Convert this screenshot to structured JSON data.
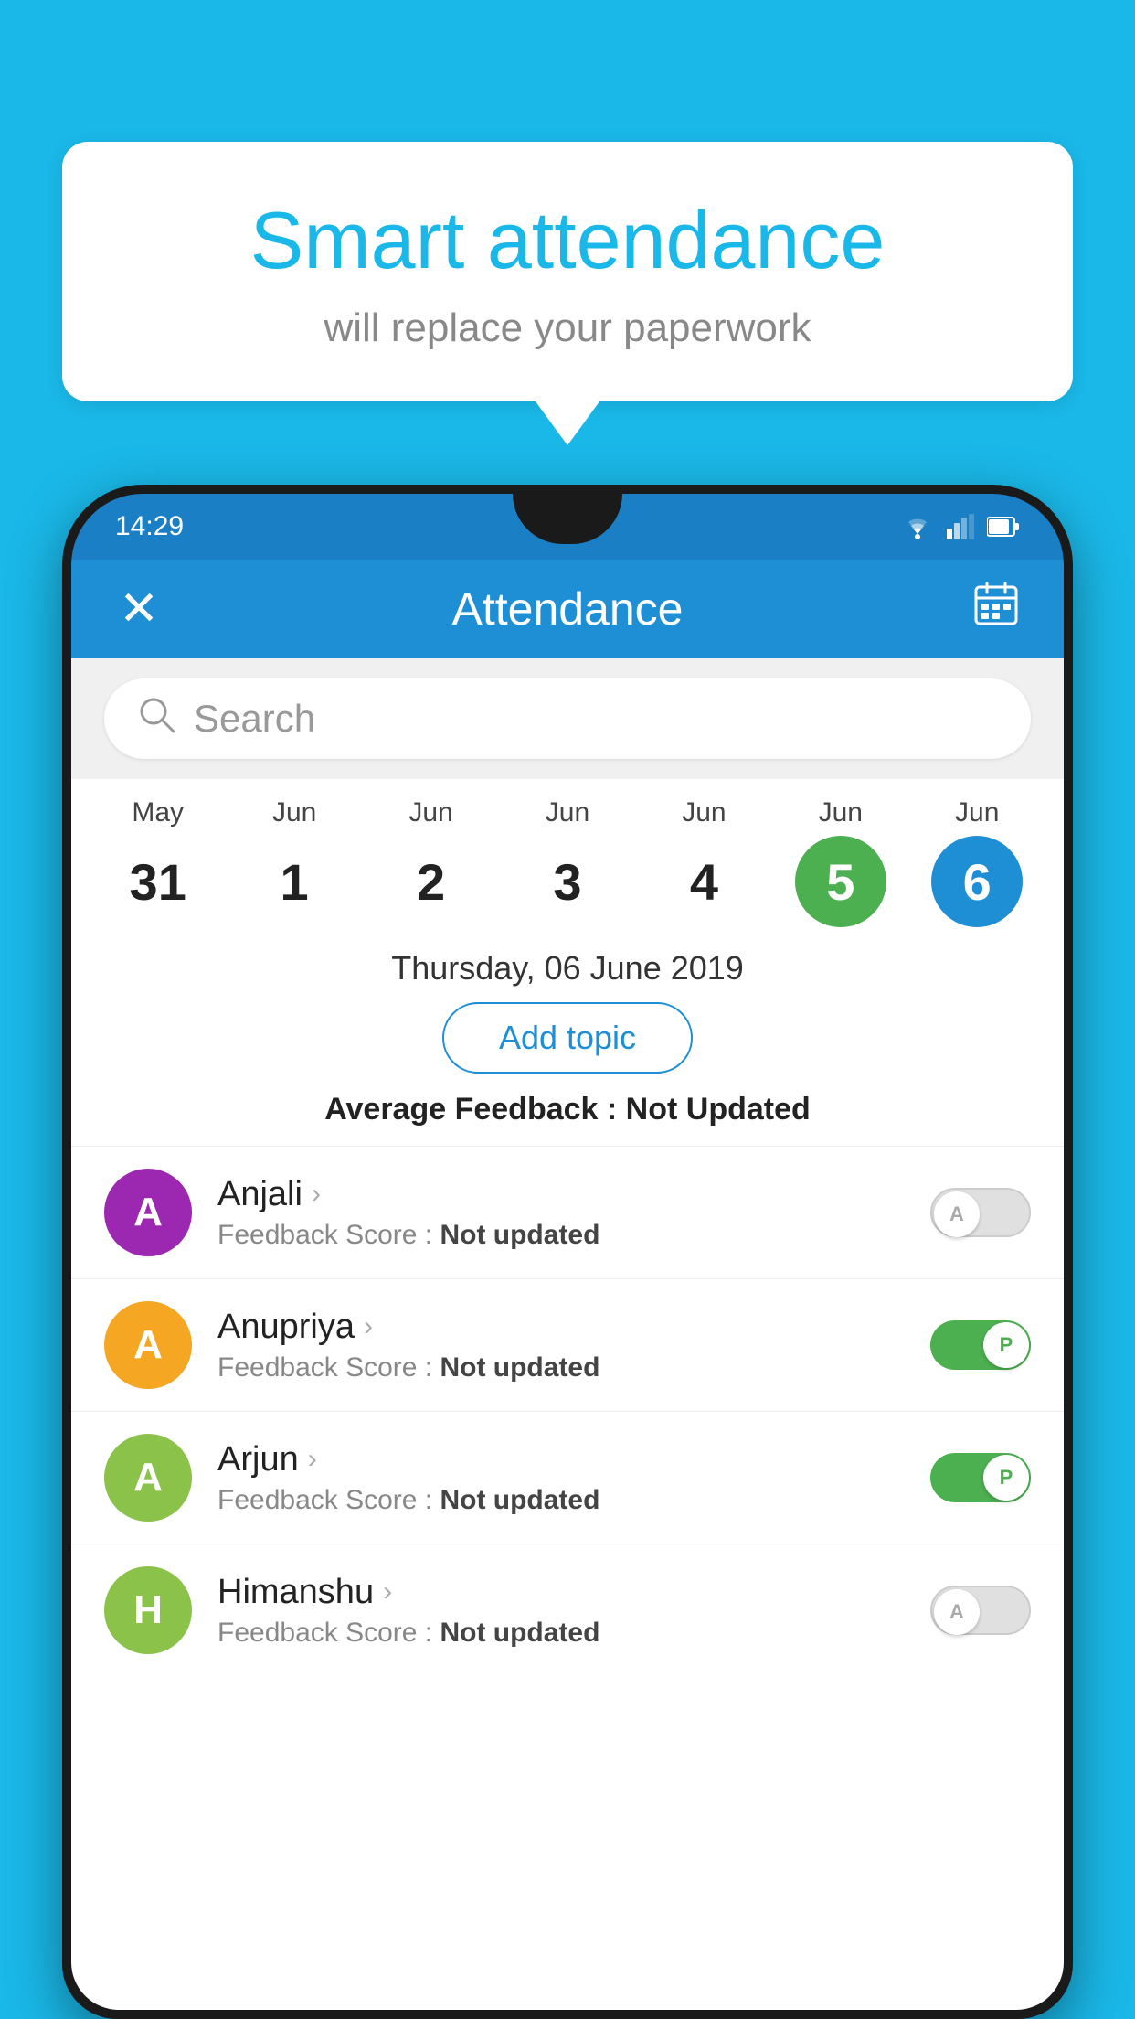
{
  "background_color": "#1ab8e8",
  "bubble": {
    "title": "Smart attendance",
    "subtitle": "will replace your paperwork"
  },
  "status_bar": {
    "time": "14:29"
  },
  "app_bar": {
    "title": "Attendance",
    "close_label": "×",
    "calendar_label": "📅"
  },
  "search": {
    "placeholder": "Search"
  },
  "calendar": {
    "days": [
      {
        "month": "May",
        "num": "31",
        "state": "normal"
      },
      {
        "month": "Jun",
        "num": "1",
        "state": "normal"
      },
      {
        "month": "Jun",
        "num": "2",
        "state": "normal"
      },
      {
        "month": "Jun",
        "num": "3",
        "state": "normal"
      },
      {
        "month": "Jun",
        "num": "4",
        "state": "normal"
      },
      {
        "month": "Jun",
        "num": "5",
        "state": "today"
      },
      {
        "month": "Jun",
        "num": "6",
        "state": "selected"
      }
    ]
  },
  "selected_date": "Thursday, 06 June 2019",
  "add_topic_label": "Add topic",
  "avg_feedback_label": "Average Feedback :",
  "avg_feedback_value": "Not Updated",
  "students": [
    {
      "name": "Anjali",
      "avatar_letter": "A",
      "avatar_color": "#9c27b0",
      "feedback_label": "Feedback Score :",
      "feedback_value": "Not updated",
      "toggle_state": "off",
      "toggle_letter": "A"
    },
    {
      "name": "Anupriya",
      "avatar_letter": "A",
      "avatar_color": "#f5a623",
      "feedback_label": "Feedback Score :",
      "feedback_value": "Not updated",
      "toggle_state": "on",
      "toggle_letter": "P"
    },
    {
      "name": "Arjun",
      "avatar_letter": "A",
      "avatar_color": "#8bc34a",
      "feedback_label": "Feedback Score :",
      "feedback_value": "Not updated",
      "toggle_state": "on",
      "toggle_letter": "P"
    },
    {
      "name": "Himanshu",
      "avatar_letter": "H",
      "avatar_color": "#8bc34a",
      "feedback_label": "Feedback Score :",
      "feedback_value": "Not updated",
      "toggle_state": "off",
      "toggle_letter": "A"
    }
  ]
}
